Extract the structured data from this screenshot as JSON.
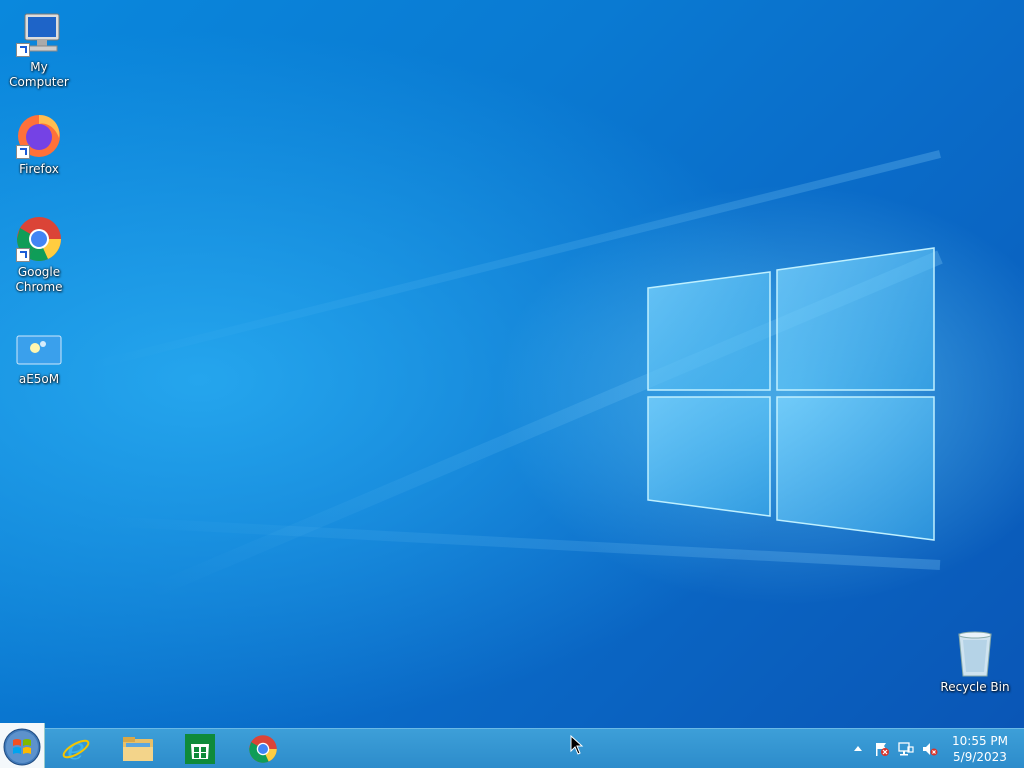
{
  "desktop": {
    "icons": [
      {
        "label": "My Computer",
        "icon": "computer-icon"
      },
      {
        "label": "Firefox",
        "icon": "firefox-icon"
      },
      {
        "label": "Google Chrome",
        "icon": "chrome-icon"
      },
      {
        "label": "aE5oM",
        "icon": "image-file-icon"
      },
      {
        "label": "Recycle Bin",
        "icon": "recycle-bin-icon"
      }
    ]
  },
  "taskbar": {
    "start": {
      "icon": "windows-orb-icon"
    },
    "pinned": [
      {
        "name": "Internet Explorer",
        "icon": "internet-explorer-icon"
      },
      {
        "name": "File Explorer",
        "icon": "folder-icon"
      },
      {
        "name": "Store",
        "icon": "store-icon"
      },
      {
        "name": "Google Chrome",
        "icon": "chrome-icon"
      }
    ],
    "tray": {
      "icons": [
        "show-hidden-icons-chevron",
        "action-center-flag-icon",
        "network-icon",
        "volume-muted-icon"
      ],
      "time": "10:55 PM",
      "date": "5/9/2023"
    }
  },
  "colors": {
    "taskbar": "#2d8ccb",
    "desktop_blue": "#0a7ad2"
  }
}
